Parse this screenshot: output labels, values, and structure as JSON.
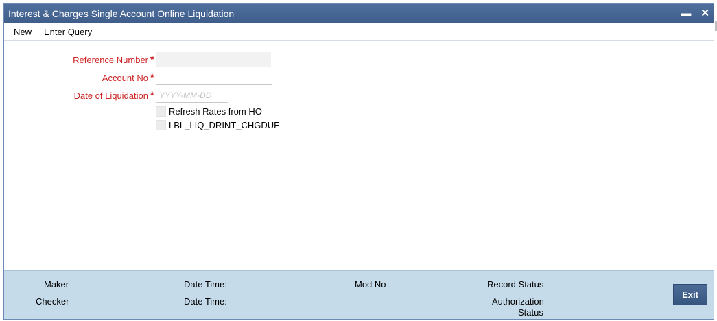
{
  "window": {
    "title": "Interest & Charges Single Account Online Liquidation",
    "minimize_glyph": "▬",
    "close_glyph": "✕"
  },
  "menu": {
    "new_label": "New",
    "enter_query_label": "Enter Query"
  },
  "form": {
    "reference_number": {
      "label": "Reference Number",
      "value": "",
      "required": "*"
    },
    "account_no": {
      "label": "Account No",
      "value": "",
      "required": "*"
    },
    "date_of_liquidation": {
      "label": "Date of Liquidation",
      "placeholder": "YYYY-MM-DD",
      "required": "*"
    },
    "refresh_rates": {
      "label": "Refresh Rates from HO",
      "checked": false
    },
    "liq_drint_chgdue": {
      "label": "LBL_LIQ_DRINT_CHGDUE",
      "checked": false
    }
  },
  "footer": {
    "maker_label": "Maker",
    "checker_label": "Checker",
    "date_time_label_1": "Date Time:",
    "date_time_label_2": "Date Time:",
    "mod_no_label": "Mod No",
    "record_status_label": "Record Status",
    "authorization_status_line1": "Authorization",
    "authorization_status_line2": "Status",
    "exit_label": "Exit"
  },
  "colors": {
    "titlebar": "#3e5d8a",
    "required_label": "#cc2222",
    "footer_bg": "#c5dbea"
  }
}
